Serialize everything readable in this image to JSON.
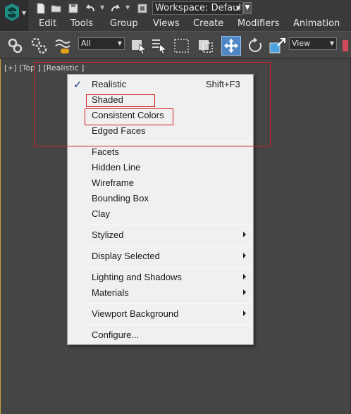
{
  "titlebar": {
    "workspace_label": "Workspace: Default"
  },
  "menubar": {
    "items": [
      "Edit",
      "Tools",
      "Group",
      "Views",
      "Create",
      "Modifiers",
      "Animation"
    ]
  },
  "toolbar": {
    "selection_filter": "All",
    "reference_coord": "View"
  },
  "viewport": {
    "label": "[+] [Top ] [Realistic ]"
  },
  "context_menu": {
    "items": [
      {
        "label": "Realistic",
        "shortcut": "Shift+F3",
        "checked": true
      },
      {
        "label": "Shaded"
      },
      {
        "label": "Consistent Colors"
      },
      {
        "label": "Edged Faces"
      },
      {
        "label": "Facets"
      },
      {
        "label": "Hidden Line"
      },
      {
        "label": "Wireframe"
      },
      {
        "label": "Bounding Box"
      },
      {
        "label": "Clay"
      },
      {
        "label": "Stylized",
        "submenu": true
      },
      {
        "label": "Display Selected",
        "submenu": true
      },
      {
        "label": "Lighting and Shadows",
        "submenu": true
      },
      {
        "label": "Materials",
        "submenu": true
      },
      {
        "label": "Viewport Background",
        "submenu": true
      },
      {
        "label": "Configure..."
      }
    ]
  },
  "colors": {
    "annotation": "#d22222",
    "viewport_border_active": "#c8a53c",
    "menu_background": "#f0f0f0"
  }
}
